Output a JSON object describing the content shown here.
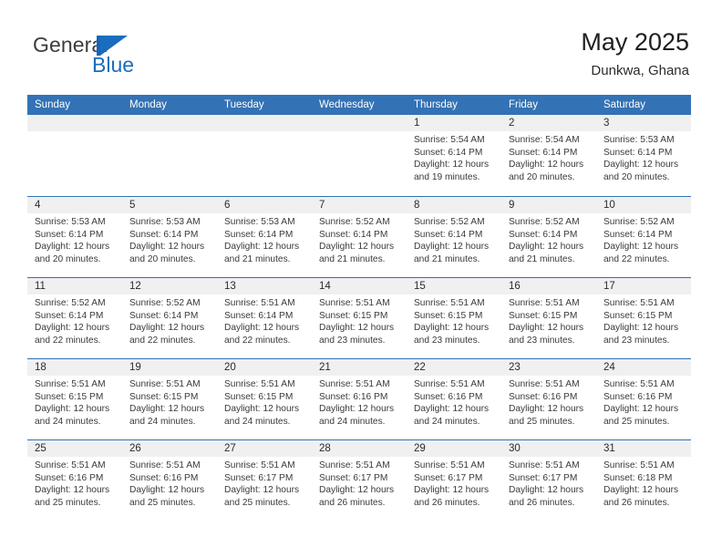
{
  "brand": {
    "name_part1": "General",
    "name_part2": "Blue",
    "mark": "triangle-logo"
  },
  "header": {
    "title": "May 2025",
    "subtitle": "Dunkwa, Ghana"
  },
  "colors": {
    "header_blue": "#3372b5",
    "brand_blue": "#1a6dbd",
    "daynum_strip": "#f0f0f0"
  },
  "weekdays": [
    "Sunday",
    "Monday",
    "Tuesday",
    "Wednesday",
    "Thursday",
    "Friday",
    "Saturday"
  ],
  "weeks": [
    [
      {
        "day": "",
        "empty": true
      },
      {
        "day": "",
        "empty": true
      },
      {
        "day": "",
        "empty": true
      },
      {
        "day": "",
        "empty": true
      },
      {
        "day": "1",
        "sunrise": "Sunrise: 5:54 AM",
        "sunset": "Sunset: 6:14 PM",
        "daylight": "Daylight: 12 hours and 19 minutes."
      },
      {
        "day": "2",
        "sunrise": "Sunrise: 5:54 AM",
        "sunset": "Sunset: 6:14 PM",
        "daylight": "Daylight: 12 hours and 20 minutes."
      },
      {
        "day": "3",
        "sunrise": "Sunrise: 5:53 AM",
        "sunset": "Sunset: 6:14 PM",
        "daylight": "Daylight: 12 hours and 20 minutes."
      }
    ],
    [
      {
        "day": "4",
        "sunrise": "Sunrise: 5:53 AM",
        "sunset": "Sunset: 6:14 PM",
        "daylight": "Daylight: 12 hours and 20 minutes."
      },
      {
        "day": "5",
        "sunrise": "Sunrise: 5:53 AM",
        "sunset": "Sunset: 6:14 PM",
        "daylight": "Daylight: 12 hours and 20 minutes."
      },
      {
        "day": "6",
        "sunrise": "Sunrise: 5:53 AM",
        "sunset": "Sunset: 6:14 PM",
        "daylight": "Daylight: 12 hours and 21 minutes."
      },
      {
        "day": "7",
        "sunrise": "Sunrise: 5:52 AM",
        "sunset": "Sunset: 6:14 PM",
        "daylight": "Daylight: 12 hours and 21 minutes."
      },
      {
        "day": "8",
        "sunrise": "Sunrise: 5:52 AM",
        "sunset": "Sunset: 6:14 PM",
        "daylight": "Daylight: 12 hours and 21 minutes."
      },
      {
        "day": "9",
        "sunrise": "Sunrise: 5:52 AM",
        "sunset": "Sunset: 6:14 PM",
        "daylight": "Daylight: 12 hours and 21 minutes."
      },
      {
        "day": "10",
        "sunrise": "Sunrise: 5:52 AM",
        "sunset": "Sunset: 6:14 PM",
        "daylight": "Daylight: 12 hours and 22 minutes."
      }
    ],
    [
      {
        "day": "11",
        "sunrise": "Sunrise: 5:52 AM",
        "sunset": "Sunset: 6:14 PM",
        "daylight": "Daylight: 12 hours and 22 minutes."
      },
      {
        "day": "12",
        "sunrise": "Sunrise: 5:52 AM",
        "sunset": "Sunset: 6:14 PM",
        "daylight": "Daylight: 12 hours and 22 minutes."
      },
      {
        "day": "13",
        "sunrise": "Sunrise: 5:51 AM",
        "sunset": "Sunset: 6:14 PM",
        "daylight": "Daylight: 12 hours and 22 minutes."
      },
      {
        "day": "14",
        "sunrise": "Sunrise: 5:51 AM",
        "sunset": "Sunset: 6:15 PM",
        "daylight": "Daylight: 12 hours and 23 minutes."
      },
      {
        "day": "15",
        "sunrise": "Sunrise: 5:51 AM",
        "sunset": "Sunset: 6:15 PM",
        "daylight": "Daylight: 12 hours and 23 minutes."
      },
      {
        "day": "16",
        "sunrise": "Sunrise: 5:51 AM",
        "sunset": "Sunset: 6:15 PM",
        "daylight": "Daylight: 12 hours and 23 minutes."
      },
      {
        "day": "17",
        "sunrise": "Sunrise: 5:51 AM",
        "sunset": "Sunset: 6:15 PM",
        "daylight": "Daylight: 12 hours and 23 minutes."
      }
    ],
    [
      {
        "day": "18",
        "sunrise": "Sunrise: 5:51 AM",
        "sunset": "Sunset: 6:15 PM",
        "daylight": "Daylight: 12 hours and 24 minutes."
      },
      {
        "day": "19",
        "sunrise": "Sunrise: 5:51 AM",
        "sunset": "Sunset: 6:15 PM",
        "daylight": "Daylight: 12 hours and 24 minutes."
      },
      {
        "day": "20",
        "sunrise": "Sunrise: 5:51 AM",
        "sunset": "Sunset: 6:15 PM",
        "daylight": "Daylight: 12 hours and 24 minutes."
      },
      {
        "day": "21",
        "sunrise": "Sunrise: 5:51 AM",
        "sunset": "Sunset: 6:16 PM",
        "daylight": "Daylight: 12 hours and 24 minutes."
      },
      {
        "day": "22",
        "sunrise": "Sunrise: 5:51 AM",
        "sunset": "Sunset: 6:16 PM",
        "daylight": "Daylight: 12 hours and 24 minutes."
      },
      {
        "day": "23",
        "sunrise": "Sunrise: 5:51 AM",
        "sunset": "Sunset: 6:16 PM",
        "daylight": "Daylight: 12 hours and 25 minutes."
      },
      {
        "day": "24",
        "sunrise": "Sunrise: 5:51 AM",
        "sunset": "Sunset: 6:16 PM",
        "daylight": "Daylight: 12 hours and 25 minutes."
      }
    ],
    [
      {
        "day": "25",
        "sunrise": "Sunrise: 5:51 AM",
        "sunset": "Sunset: 6:16 PM",
        "daylight": "Daylight: 12 hours and 25 minutes."
      },
      {
        "day": "26",
        "sunrise": "Sunrise: 5:51 AM",
        "sunset": "Sunset: 6:16 PM",
        "daylight": "Daylight: 12 hours and 25 minutes."
      },
      {
        "day": "27",
        "sunrise": "Sunrise: 5:51 AM",
        "sunset": "Sunset: 6:17 PM",
        "daylight": "Daylight: 12 hours and 25 minutes."
      },
      {
        "day": "28",
        "sunrise": "Sunrise: 5:51 AM",
        "sunset": "Sunset: 6:17 PM",
        "daylight": "Daylight: 12 hours and 26 minutes."
      },
      {
        "day": "29",
        "sunrise": "Sunrise: 5:51 AM",
        "sunset": "Sunset: 6:17 PM",
        "daylight": "Daylight: 12 hours and 26 minutes."
      },
      {
        "day": "30",
        "sunrise": "Sunrise: 5:51 AM",
        "sunset": "Sunset: 6:17 PM",
        "daylight": "Daylight: 12 hours and 26 minutes."
      },
      {
        "day": "31",
        "sunrise": "Sunrise: 5:51 AM",
        "sunset": "Sunset: 6:18 PM",
        "daylight": "Daylight: 12 hours and 26 minutes."
      }
    ]
  ]
}
